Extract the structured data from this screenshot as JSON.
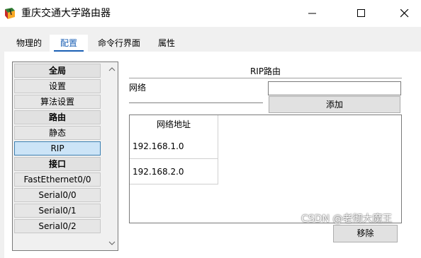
{
  "window": {
    "title": "重庆交通大学路由器",
    "icon": "router-app-icon",
    "controls": {
      "minimize": "minimize-icon",
      "maximize": "maximize-icon",
      "close": "close-icon"
    }
  },
  "tabs": [
    {
      "label": "物理的"
    },
    {
      "label": "配置",
      "active": true
    },
    {
      "label": "命令行界面"
    },
    {
      "label": "属性"
    }
  ],
  "sidebar": {
    "items": [
      {
        "label": "全局",
        "type": "header"
      },
      {
        "label": "设置"
      },
      {
        "label": "算法设置"
      },
      {
        "label": "路由",
        "type": "header"
      },
      {
        "label": "静态"
      },
      {
        "label": "RIP",
        "selected": true
      },
      {
        "label": "接口",
        "type": "header"
      },
      {
        "label": "FastEthernet0/0"
      },
      {
        "label": "Serial0/0"
      },
      {
        "label": "Serial0/1"
      },
      {
        "label": "Serial0/2"
      }
    ]
  },
  "rip": {
    "title": "RIP路由",
    "network_label": "网络",
    "network_value": "",
    "add_label": "添加",
    "table": {
      "header": "网络地址",
      "rows": [
        "192.168.1.0",
        "192.168.2.0"
      ]
    },
    "remove_label": "移除"
  },
  "watermark": "CSDN @老彻大魔王",
  "colors": {
    "accent": "#1a5fb4",
    "selected_bg": "#cce4f7",
    "chrome": "#f0f0f0"
  }
}
